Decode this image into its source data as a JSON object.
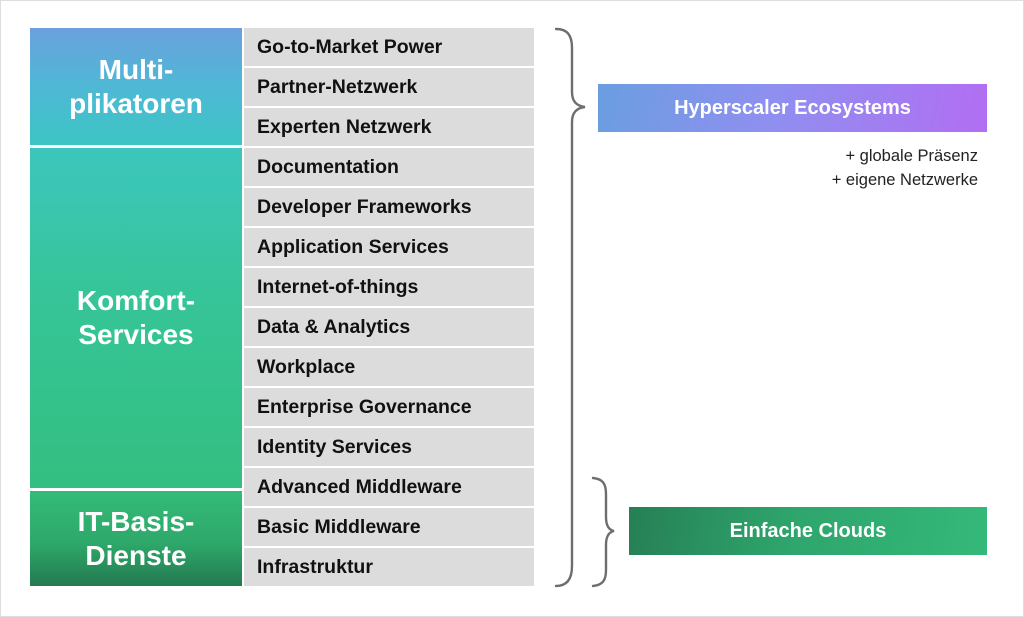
{
  "categories": [
    {
      "id": "multiplikatoren",
      "lines": [
        "Multi-",
        "plikatoren"
      ],
      "color_top": "#6aa0dc",
      "color_bottom": "#3cc5c3"
    },
    {
      "id": "komfort-services",
      "lines": [
        "Komfort-",
        "Services"
      ],
      "color_top": "#3cc6bd",
      "color_bottom": "#33bf80"
    },
    {
      "id": "it-basis-dienste",
      "lines": [
        "IT-Basis-",
        "Dienste"
      ],
      "color_top": "#34bb78",
      "color_bottom": "#237a50"
    }
  ],
  "services": [
    "Go-to-Market Power",
    "Partner-Netzwerk",
    "Experten Netzwerk",
    "Documentation",
    "Developer Frameworks",
    "Application Services",
    "Internet-of-things",
    "Data & Analytics",
    "Workplace",
    "Enterprise Governance",
    "Identity Services",
    "Advanced Middleware",
    "Basic Middleware",
    "Infrastruktur"
  ],
  "groups": {
    "hyperscaler": {
      "label": "Hyperscaler Ecosystems",
      "notes": [
        "+ globale Präsenz",
        "+ eigene Netzwerke"
      ],
      "colors": [
        "#6a9ee0",
        "#b26ef2"
      ]
    },
    "simple": {
      "label": "Einfache Clouds",
      "colors": [
        "#267f55",
        "#34b97a"
      ]
    }
  },
  "colors": {
    "cell_background": "#dcdcdc",
    "brace": "#6e6e6e"
  }
}
